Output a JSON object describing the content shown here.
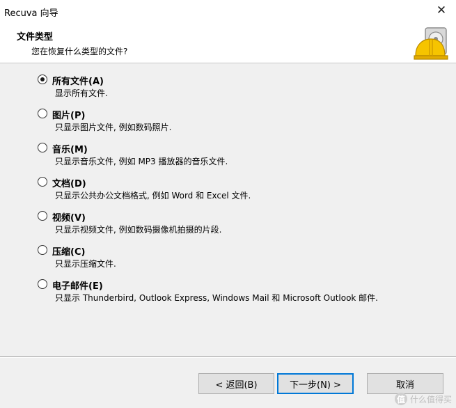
{
  "window": {
    "title": "Recuva 向导",
    "close_glyph": "✕"
  },
  "header": {
    "title": "文件类型",
    "subtitle": "您在恢复什么类型的文件?",
    "icon": "recuva-hardhat-drive-icon"
  },
  "options": [
    {
      "label": "所有文件(A)",
      "desc": "显示所有文件.",
      "checked": true
    },
    {
      "label": "图片(P)",
      "desc": "只显示图片文件, 例如数码照片.",
      "checked": false
    },
    {
      "label": "音乐(M)",
      "desc": "只显示音乐文件, 例如 MP3 播放器的音乐文件.",
      "checked": false
    },
    {
      "label": "文档(D)",
      "desc": "只显示公共办公文档格式, 例如 Word 和 Excel 文件.",
      "checked": false
    },
    {
      "label": "视频(V)",
      "desc": "只显示视频文件, 例如数码摄像机拍摄的片段.",
      "checked": false
    },
    {
      "label": "压缩(C)",
      "desc": "只显示压缩文件.",
      "checked": false
    },
    {
      "label": "电子邮件(E)",
      "desc": "只显示 Thunderbird, Outlook Express,  Windows Mail 和 Microsoft Outlook 邮件.",
      "checked": false
    }
  ],
  "buttons": {
    "back": "< 返回(B)",
    "next": "下一步(N) >",
    "cancel": "取消"
  },
  "watermark": {
    "glyph": "值",
    "text": "什么值得买"
  },
  "colors": {
    "accent": "#0078d7",
    "background": "#f0f0f0",
    "header_bg": "#ffffff"
  }
}
